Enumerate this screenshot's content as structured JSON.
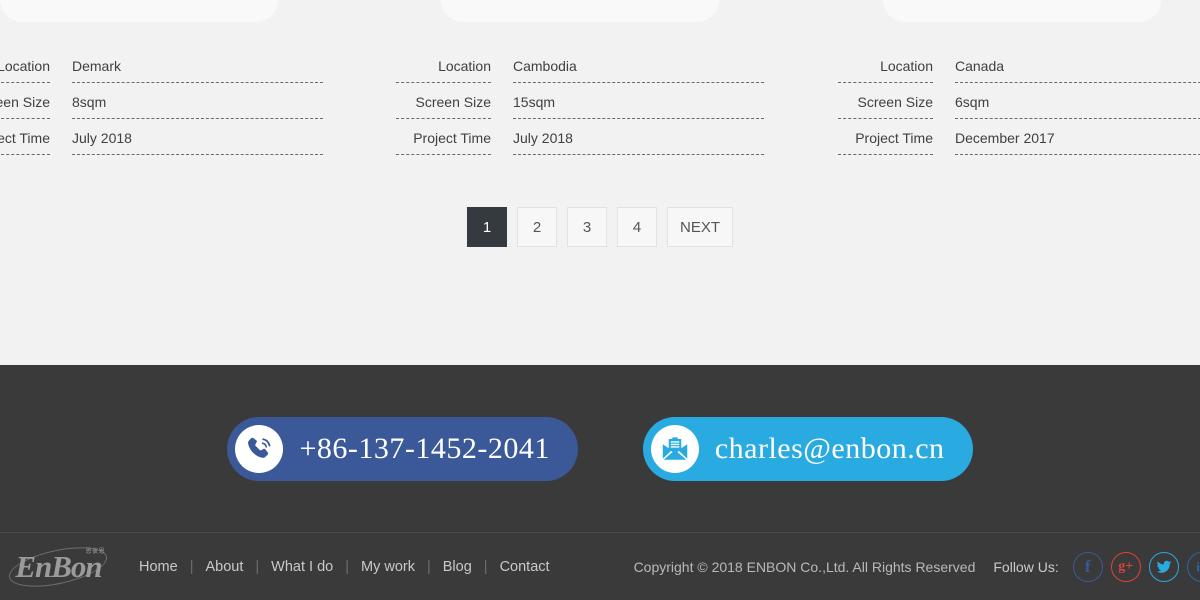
{
  "cards": [
    {
      "rows": [
        {
          "label": "Location",
          "value": "Demark"
        },
        {
          "label": "Screen Size",
          "value": "8sqm"
        },
        {
          "label": "Project Time",
          "value": "July 2018"
        }
      ]
    },
    {
      "rows": [
        {
          "label": "Location",
          "value": "Cambodia"
        },
        {
          "label": "Screen Size",
          "value": "15sqm"
        },
        {
          "label": "Project Time",
          "value": "July 2018"
        }
      ]
    },
    {
      "rows": [
        {
          "label": "Location",
          "value": "Canada"
        },
        {
          "label": "Screen Size",
          "value": "6sqm"
        },
        {
          "label": "Project Time",
          "value": "December 2017"
        }
      ]
    }
  ],
  "pagination": {
    "pages": [
      "1",
      "2",
      "3",
      "4"
    ],
    "active": "1",
    "next_label": "NEXT"
  },
  "contact": {
    "phone": {
      "text": "+86-137-1452-2041",
      "icon": "phone-icon",
      "color": "#3b5998"
    },
    "email": {
      "text": "charles@enbon.cn",
      "icon": "envelope-icon",
      "color": "#29abe2"
    }
  },
  "footer": {
    "logo": {
      "text": "EnBon",
      "sub": "恩彼恩"
    },
    "nav": [
      "Home",
      "About",
      "What I do",
      "My work",
      "Blog",
      "Contact"
    ],
    "separator": "|",
    "copyright": "Copyright © 2018 ENBON Co.,Ltd. All Rights Reserved",
    "follow_label": "Follow Us:",
    "socials": [
      {
        "name": "facebook-icon",
        "glyph": "f",
        "color": "#3b5998"
      },
      {
        "name": "google-plus-icon",
        "glyph": "g+",
        "color": "#db4437"
      },
      {
        "name": "twitter-icon",
        "glyph": "✉",
        "color": "#29abe2"
      },
      {
        "name": "linkedin-icon",
        "glyph": "in",
        "color": "#2867b2"
      }
    ]
  }
}
